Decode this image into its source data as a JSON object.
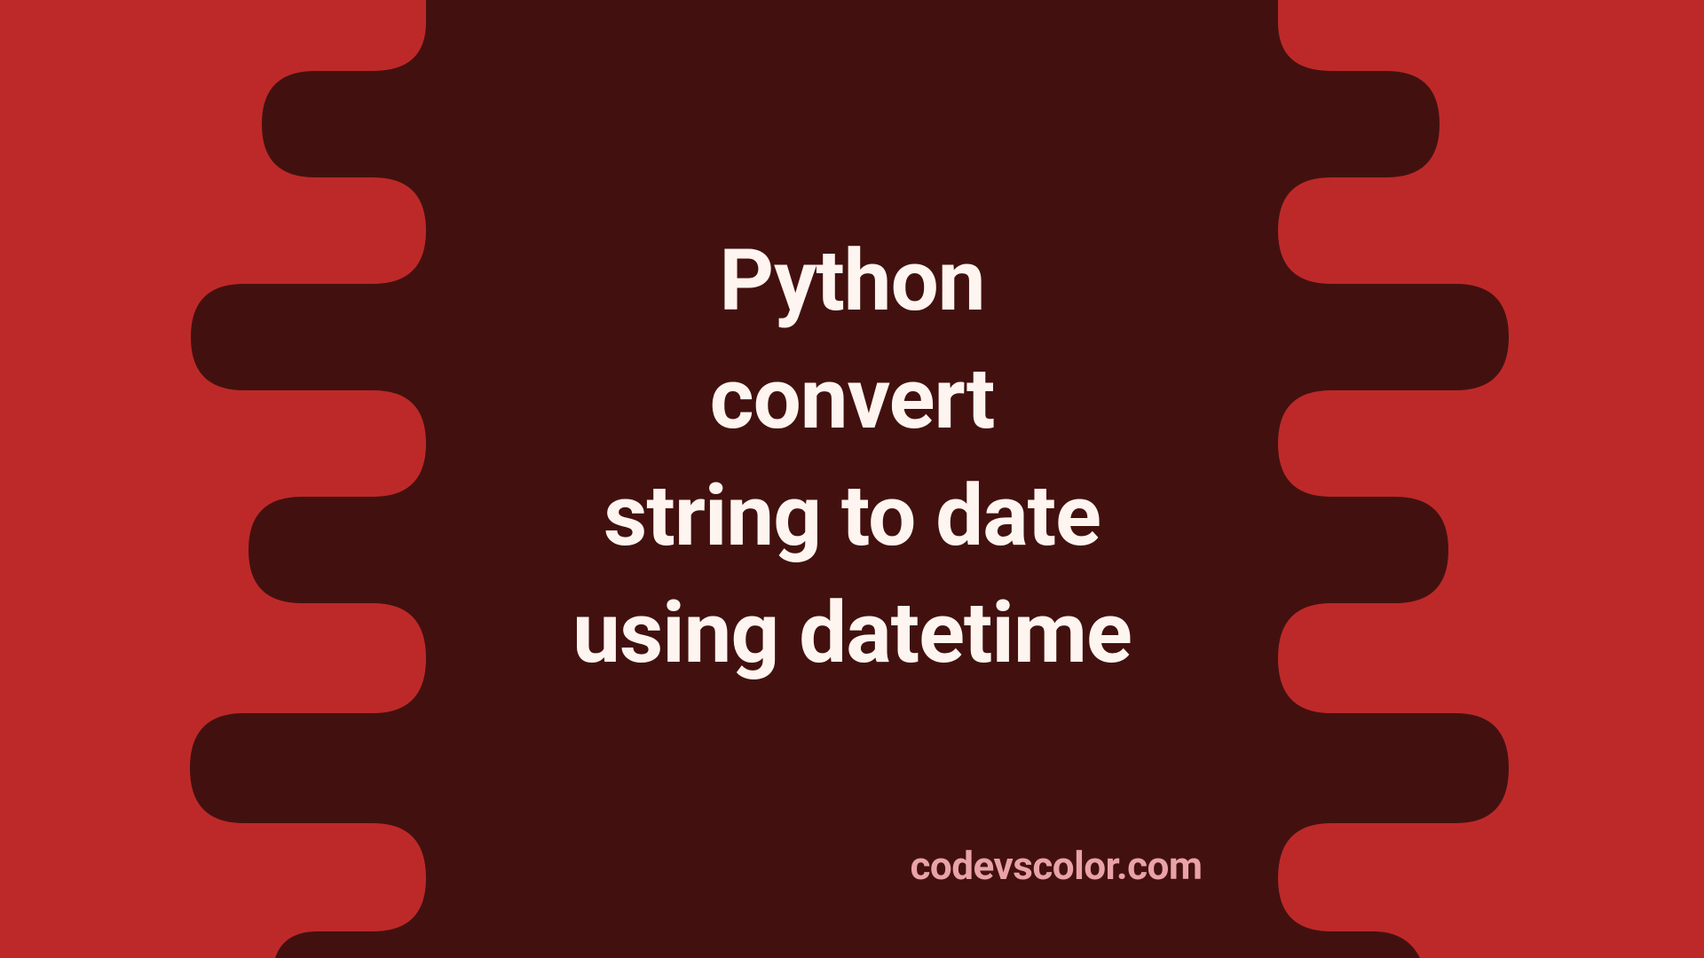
{
  "colors": {
    "outer": "#bd2929",
    "inner": "#42110f",
    "text": "#fff5f0",
    "attribution": "#e9a2a8"
  },
  "title": {
    "line1": "Python",
    "line2": "convert",
    "line3": "string to date",
    "line4": "using datetime"
  },
  "attribution": "codevscolor.com"
}
